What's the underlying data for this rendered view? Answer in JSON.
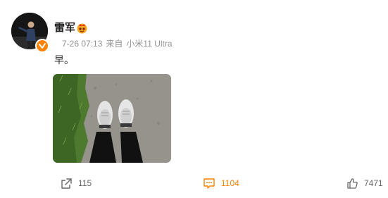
{
  "post": {
    "author": {
      "name": "雷军"
    },
    "meta": {
      "time": "7-26 07:13",
      "source_prefix": "来自",
      "source": "小米11 Ultra"
    },
    "text": "早。",
    "actions": {
      "share_count": "115",
      "comment_count": "1104",
      "like_count": "7471"
    }
  },
  "colors": {
    "accent": "#ff8200",
    "meta_gray": "#939393",
    "action_gray": "#666666"
  },
  "icons": {
    "verified": "verified-badge-icon",
    "vip": "vip-crown-icon",
    "share": "share-icon",
    "comment": "comment-icon",
    "like": "thumbs-up-icon"
  }
}
